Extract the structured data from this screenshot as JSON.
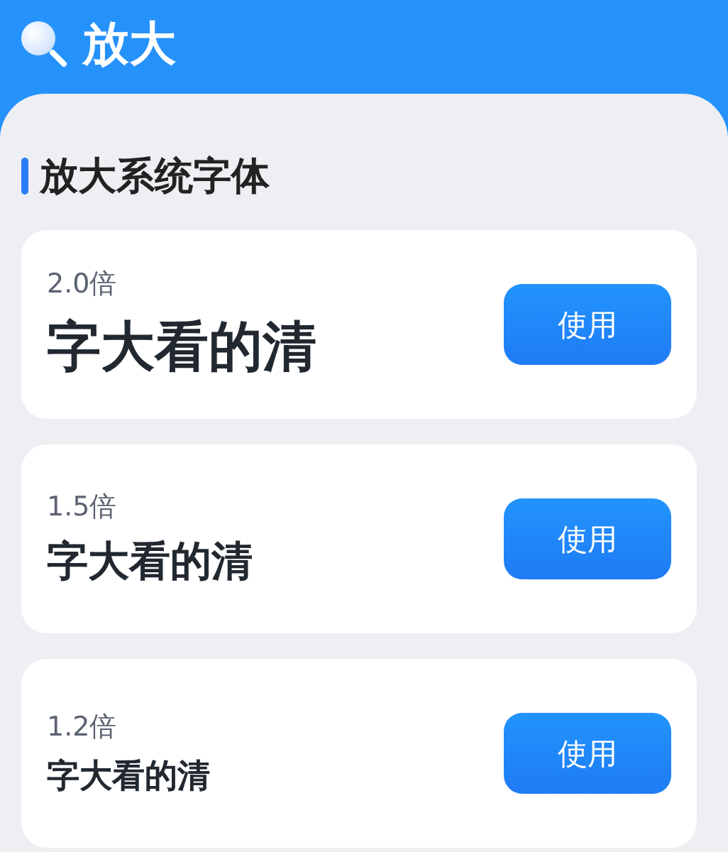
{
  "header": {
    "title": "放大"
  },
  "section": {
    "title": "放大系统字体"
  },
  "options": [
    {
      "scale": "2.0倍",
      "sample": "字大看的清",
      "kind": "large",
      "button": "使用"
    },
    {
      "scale": "1.5倍",
      "sample": "字大看的清",
      "kind": "medium",
      "button": "使用"
    },
    {
      "scale": "1.2倍",
      "sample": "字大看的清",
      "kind": "small",
      "button": "使用"
    }
  ]
}
